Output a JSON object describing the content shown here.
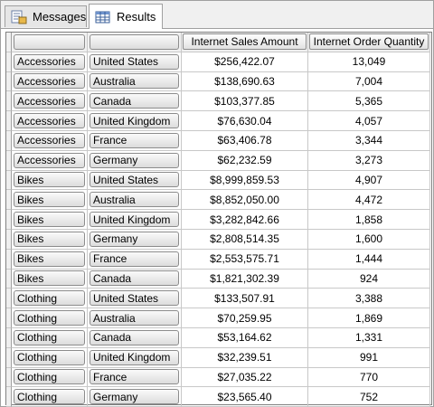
{
  "tabs": [
    {
      "label": "Messages",
      "icon": "messages-icon"
    },
    {
      "label": "Results",
      "icon": "results-grid-icon"
    }
  ],
  "grid": {
    "columns": [
      "",
      "",
      "Internet Sales Amount",
      "Internet Order Quantity"
    ],
    "rows": [
      [
        "Accessories",
        "United States",
        "$256,422.07",
        "13,049"
      ],
      [
        "Accessories",
        "Australia",
        "$138,690.63",
        "7,004"
      ],
      [
        "Accessories",
        "Canada",
        "$103,377.85",
        "5,365"
      ],
      [
        "Accessories",
        "United Kingdom",
        "$76,630.04",
        "4,057"
      ],
      [
        "Accessories",
        "France",
        "$63,406.78",
        "3,344"
      ],
      [
        "Accessories",
        "Germany",
        "$62,232.59",
        "3,273"
      ],
      [
        "Bikes",
        "United States",
        "$8,999,859.53",
        "4,907"
      ],
      [
        "Bikes",
        "Australia",
        "$8,852,050.00",
        "4,472"
      ],
      [
        "Bikes",
        "United Kingdom",
        "$3,282,842.66",
        "1,858"
      ],
      [
        "Bikes",
        "Germany",
        "$2,808,514.35",
        "1,600"
      ],
      [
        "Bikes",
        "France",
        "$2,553,575.71",
        "1,444"
      ],
      [
        "Bikes",
        "Canada",
        "$1,821,302.39",
        "924"
      ],
      [
        "Clothing",
        "United States",
        "$133,507.91",
        "3,388"
      ],
      [
        "Clothing",
        "Australia",
        "$70,259.95",
        "1,869"
      ],
      [
        "Clothing",
        "Canada",
        "$53,164.62",
        "1,331"
      ],
      [
        "Clothing",
        "United Kingdom",
        "$32,239.51",
        "991"
      ],
      [
        "Clothing",
        "France",
        "$27,035.22",
        "770"
      ],
      [
        "Clothing",
        "Germany",
        "$23,565.40",
        "752"
      ]
    ]
  }
}
